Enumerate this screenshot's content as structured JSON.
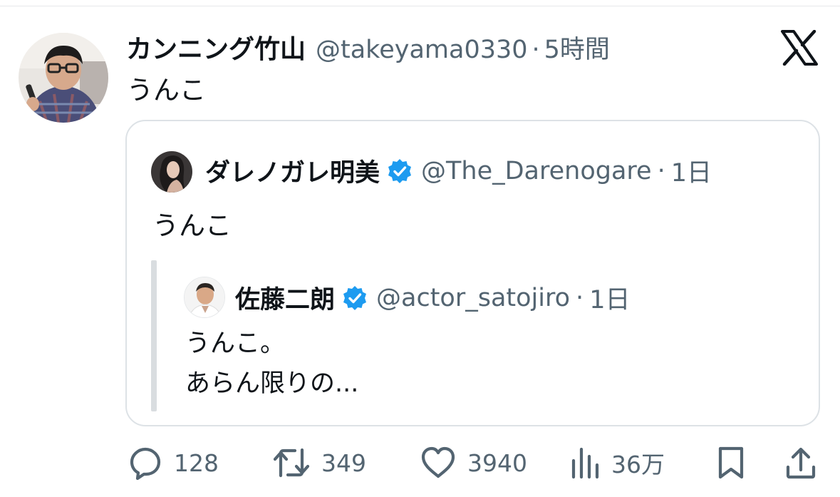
{
  "tweet": {
    "author_name": "カンニング竹山",
    "author_handle": "@takeyama0330",
    "separator": "·",
    "time": "5時間",
    "text": "うんこ"
  },
  "quoted": {
    "author_name": "ダレノガレ明美",
    "author_handle": "@The_Darenogare",
    "separator": "·",
    "time": "1日",
    "text": "うんこ",
    "verified": true
  },
  "nested_quote": {
    "author_name": "佐藤二朗",
    "author_handle": "@actor_satojiro",
    "separator": "·",
    "time": "1日",
    "text_line1": "うんこ。",
    "text_line2": "あらん限りの...",
    "verified": true
  },
  "actions": {
    "reply_count": "128",
    "retweet_count": "349",
    "like_count": "3940",
    "views_count": "36万"
  },
  "icons": {
    "platform": "x-logo-icon",
    "verified": "verified-badge-icon",
    "reply": "reply-icon",
    "retweet": "retweet-icon",
    "like": "heart-icon",
    "views": "views-bar-chart-icon",
    "bookmark": "bookmark-icon",
    "share": "share-icon"
  },
  "colors": {
    "text_primary": "#0f1419",
    "text_secondary": "#536471",
    "verified_blue": "#1d9bf0",
    "border": "#dde2e6"
  }
}
